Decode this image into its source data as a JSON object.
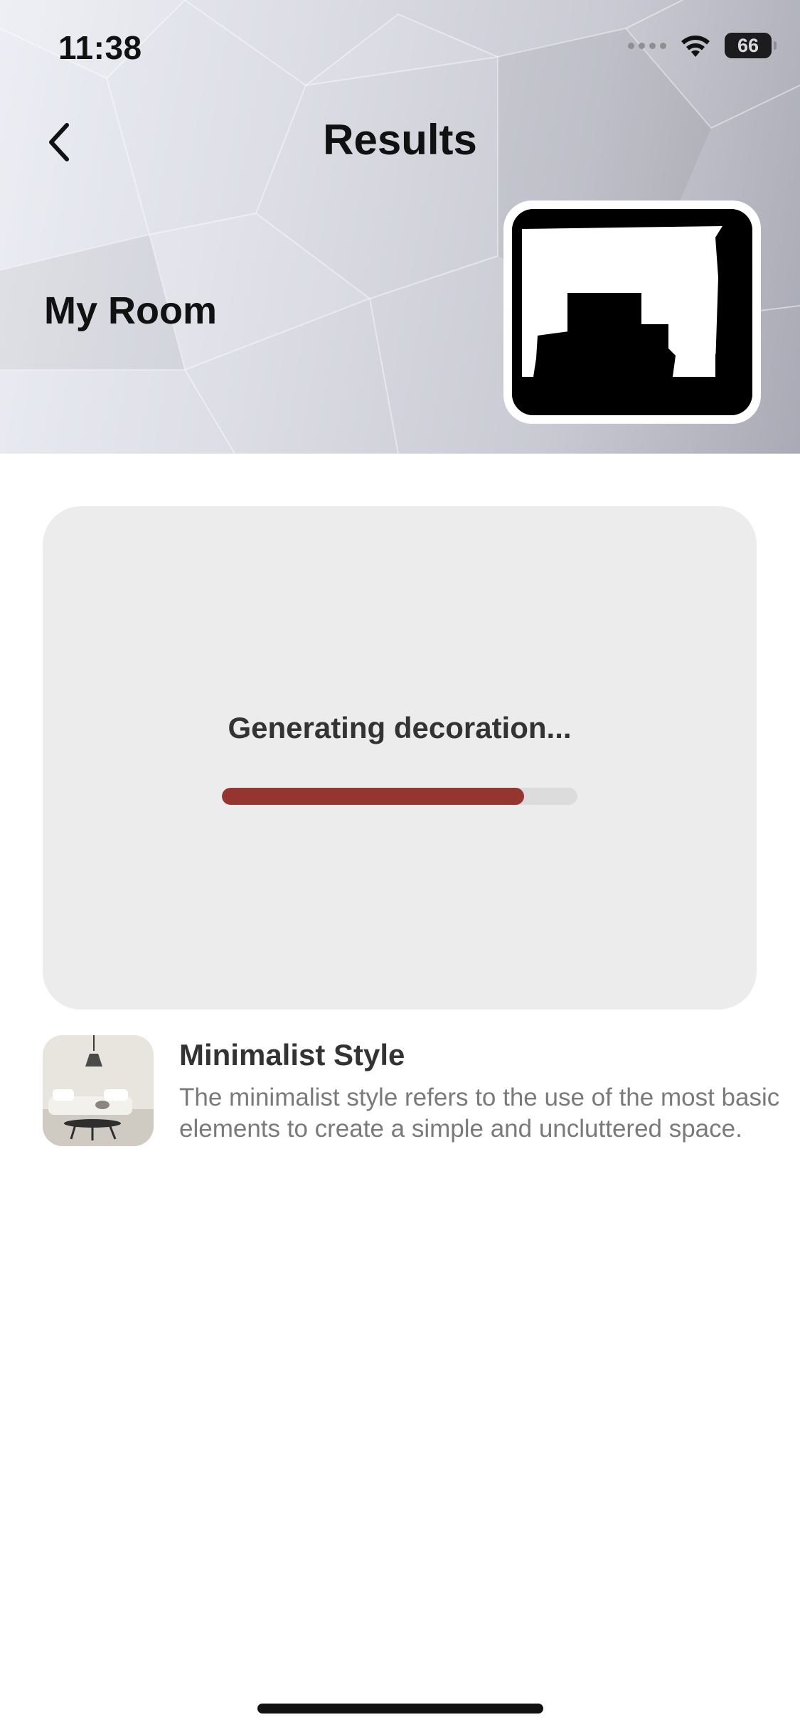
{
  "status_bar": {
    "time": "11:38",
    "battery": "66",
    "icons": [
      "cellular-signal-icon",
      "wifi-icon",
      "battery-icon"
    ]
  },
  "nav": {
    "title": "Results",
    "back_icon": "chevron-left-icon"
  },
  "room": {
    "label": "My Room"
  },
  "generation": {
    "status_text": "Generating decoration...",
    "progress": 0.85,
    "progress_color": "#943530",
    "track_color": "#dcdcdc"
  },
  "style": {
    "title": "Minimalist Style",
    "description": "The minimalist style refers to the use of the most basic elements to create a simple and uncluttered space."
  },
  "colors": {
    "accent": "#943530",
    "card_background": "#ececec",
    "text_primary": "#111111",
    "text_secondary": "#7a7a7a"
  }
}
